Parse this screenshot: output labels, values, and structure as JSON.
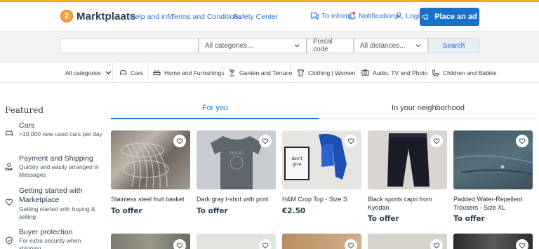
{
  "header": {
    "logo_badge": "2",
    "logo_text": "Marktplaats",
    "links": [
      "Help and info",
      "Terms and Conditions",
      "Safety Center"
    ],
    "inform": "To inform",
    "notifications": "Notifications",
    "login": "Login",
    "place_ad": "Place an ad",
    "accent_color": "#f5a623",
    "brand_color": "#1a72c6"
  },
  "search": {
    "query_value": "",
    "category_select": "All categories...",
    "postal_code_placeholder": "Postal code",
    "distance_select": "All distances...",
    "search_button": "Search"
  },
  "categories": {
    "all": "All categories",
    "items": [
      {
        "label": "Cars",
        "icon": "car-icon"
      },
      {
        "label": "Home and Furnishings",
        "icon": "sofa-icon"
      },
      {
        "label": "Garden and Terrace",
        "icon": "garden-icon"
      },
      {
        "label": "Clothing | Women",
        "icon": "clothing-icon"
      },
      {
        "label": "Audio, TV and Photo",
        "icon": "camera-icon"
      },
      {
        "label": "Children and Babies",
        "icon": "baby-icon"
      }
    ]
  },
  "sidebar": {
    "title": "Featured",
    "items": [
      {
        "title": "Cars",
        "subtitle": ">10,000 new used cars per day",
        "icon": "car-icon"
      },
      {
        "title": "Payment and Shipping",
        "subtitle": "Quickly and easily arranged in Messages",
        "icon": "payment-icon"
      },
      {
        "title": "Getting started with Marketplace",
        "subtitle": "Getting started with buying & selling",
        "icon": "heart-icon"
      },
      {
        "title": "Buyer protection",
        "subtitle": "For extra security when shipping",
        "icon": "shield-icon"
      }
    ]
  },
  "tabs": {
    "for_you": "For you",
    "neighborhood": "In your neighborhood"
  },
  "listings": [
    {
      "title": "Stainless steel fruit basket",
      "price": "To offer"
    },
    {
      "title": "Dark gray t-shirt with print",
      "price": "To offer"
    },
    {
      "title": "H&M Crop Top - Size S",
      "price": "€2.50"
    },
    {
      "title": "Black sports capri from Kyodan",
      "price": "To offer"
    },
    {
      "title": "Padded Water-Repellent Trousers - Size XL",
      "price": "To offer"
    }
  ]
}
